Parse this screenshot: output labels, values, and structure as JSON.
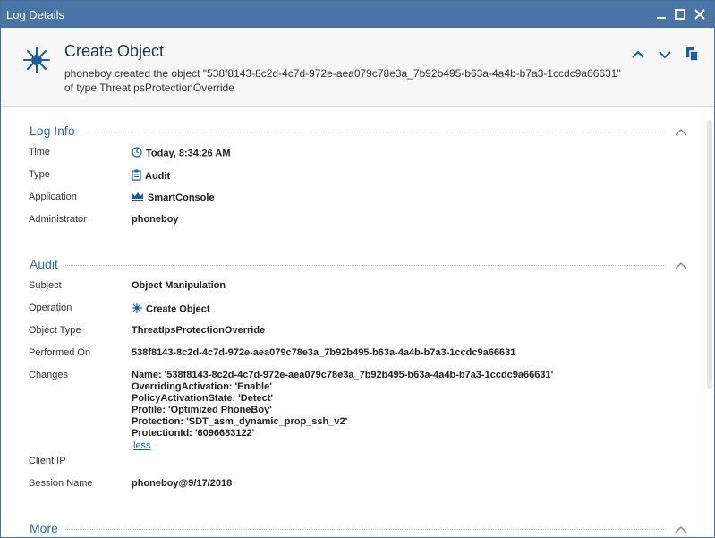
{
  "window": {
    "title": "Log Details"
  },
  "header": {
    "title": "Create Object",
    "description": "phoneboy created the object \"538f8143-8c2d-4c7d-972e-aea079c78e3a_7b92b495-b63a-4a4b-b7a3-1ccdc9a66631\" of type ThreatIpsProtectionOverride",
    "icon": "sparkle-icon"
  },
  "sections": {
    "log_info": {
      "label": "Log Info",
      "time_label": "Time",
      "time_value": "Today, 8:34:26 AM",
      "type_label": "Type",
      "type_value": "Audit",
      "application_label": "Application",
      "application_value": "SmartConsole",
      "administrator_label": "Administrator",
      "administrator_value": "phoneboy"
    },
    "audit": {
      "label": "Audit",
      "subject_label": "Subject",
      "subject_value": "Object Manipulation",
      "operation_label": "Operation",
      "operation_value": "Create Object",
      "object_type_label": "Object Type",
      "object_type_value": "ThreatIpsProtectionOverride",
      "performed_on_label": "Performed On",
      "performed_on_value": "538f8143-8c2d-4c7d-972e-aea079c78e3a_7b92b495-b63a-4a4b-b7a3-1ccdc9a66631",
      "changes_label": "Changes",
      "changes": [
        "Name: '538f8143-8c2d-4c7d-972e-aea079c78e3a_7b92b495-b63a-4a4b-b7a3-1ccdc9a66631'",
        "OverridingActivation: 'Enable'",
        "PolicyActivationState: 'Detect'",
        "Profile: 'Optimized PhoneBoy'",
        "Protection: 'SDT_asm_dynamic_prop_ssh_v2'",
        "ProtectionId: '6096683122'"
      ],
      "less_link": "less",
      "client_ip_label": "Client IP",
      "client_ip_value": "",
      "session_name_label": "Session Name",
      "session_name_value": "phoneboy@9/17/2018"
    },
    "more": {
      "label": "More"
    }
  },
  "colors": {
    "titlebar": "#4874a6",
    "section_label": "#2f6fa8",
    "accent_icon": "#1f5f96"
  }
}
